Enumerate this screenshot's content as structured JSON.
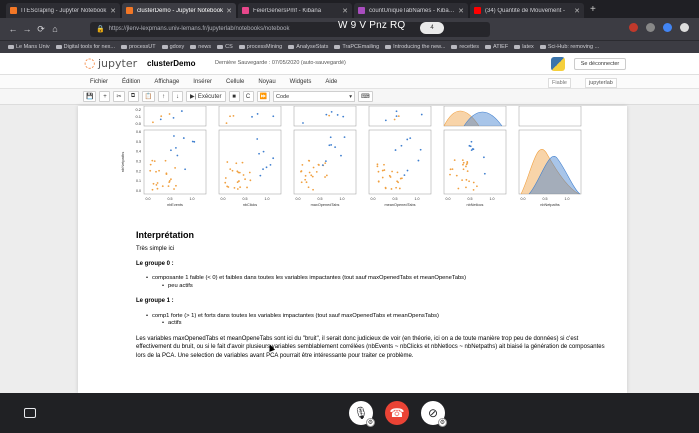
{
  "browser": {
    "tabs": [
      {
        "label": "ITEScraping - Jupyter Notebook",
        "color": "#f37726",
        "active": false
      },
      {
        "label": "clusterDemo - Jupyter Notebook",
        "color": "#f37726",
        "active": true
      },
      {
        "label": "FeierGenersPmf - Kibana",
        "color": "#e8478b",
        "active": false
      },
      {
        "label": "countUniqueTabNames - Kibana",
        "color": "#a94dbf",
        "active": false
      },
      {
        "label": "(34) Quantité de Mouvement - ",
        "color": "#ff0000",
        "active": false
      }
    ],
    "new_tab": "+",
    "url": "https://jlenv-lexpmans.univ-lemans.fr/jupyterlab/notebooks/notebook",
    "meeting_code": "W 9 V Pnz RQ",
    "meeting_pill": "4",
    "bookmarks": [
      "Le Mans Univ",
      "Digital tools for nex...",
      "processUT",
      "gdoxy",
      "news",
      "CS",
      "processMining",
      "AnalyseStats",
      "TraPCEmailing",
      "Introducing the new...",
      "recettes",
      "ATIEF",
      "latex",
      "Sci-Hub: removing ..."
    ]
  },
  "jupyter": {
    "logo_text": "jupyter",
    "notebook_name": "clusterDemo",
    "save_state": "Dernière Sauvegarde : 07/05/2020  (auto-sauvegardé)",
    "logout_label": "Se déconnecter",
    "menu": [
      "Fichier",
      "Édition",
      "Affichage",
      "Insérer",
      "Cellule",
      "Noyau",
      "Widgets",
      "Aide"
    ],
    "trusted_label": "Fiable",
    "kernel_label": "jupyterlab",
    "run_label": "Exécuter",
    "cell_type": "Code"
  },
  "markdown": {
    "heading": "Interprétation",
    "intro": "Très simple ici",
    "group0_title": "Le groupe 0 :",
    "group0_item": "composante 1 faible (< 0) et faibles dans toutes les variables impactantes (tout sauf maxOpenedTabs et meanOpeneTabs)",
    "group0_sub": "peu actifs",
    "group1_title": "Le groupe 1 :",
    "group1_item": "comp1 forte (> 1) et forts dans toutes les variables impactantes (tout sauf maxOpenedTabs et meanOpensTabs)",
    "group1_sub": "actifs",
    "conclusion": "Les variables maxOpenedTabs et meanOpeneTabs sont ici du \"bruit\", il serait donc judicieux de voir (en théorie, ici on a de toute manière trop peu de données) si c'est effectivement du bruit, ou si le fait d'avoir plusieurs variables semblablement corrélées (nbEvents ~ nbClicks et nbNetlocs ~ nbNetpaths) ait biaisé la génération de composantes lors de la PCA. Une selection de variables avant PCA pourrait être intéressante pour traiter ce problème."
  },
  "plots": {
    "ylabel": "nbNetpaths",
    "xlabels": [
      "nbEvents",
      "nbClicks",
      "maxOpenedTabs",
      "meanOpenedTabs",
      "nbNetlocs",
      "nbNetpaths"
    ],
    "xticks": [
      "0.0",
      "0.5",
      "1.0"
    ],
    "yticks_top": [
      "0.2",
      "0.1",
      "0.0"
    ],
    "yticks": [
      "0.6",
      "0.5",
      "0.4",
      "0.3",
      "0.2",
      "0.1",
      "0.0"
    ],
    "colors": {
      "cluster0": "#f0a040",
      "cluster1": "#3f7fcf"
    }
  },
  "meeting": {
    "mic_icon": "microphone-icon",
    "hangup_icon": "hangup-icon",
    "camera_icon": "camera-off-icon"
  }
}
